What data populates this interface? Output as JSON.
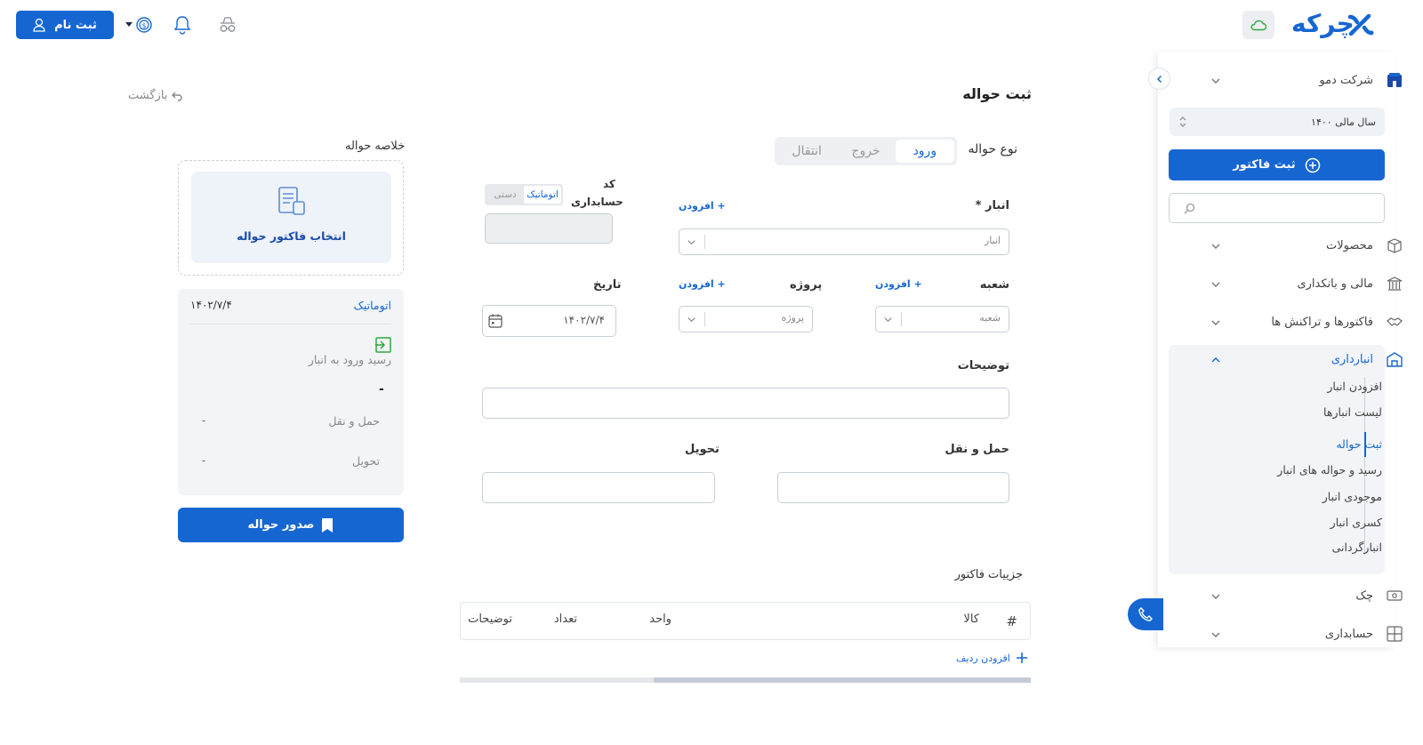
{
  "header": {
    "signup_label": "ثبت نام",
    "brand_name": "چرکه"
  },
  "sidebar": {
    "company": "شرکت دمو",
    "fiscal_year": "سال مالی ۱۴۰۰",
    "new_invoice_label": "ثبت فاکتور",
    "items": [
      {
        "label": "محصولات"
      },
      {
        "label": "مالی و بانکداری"
      },
      {
        "label": "فاکتورها و تراکنش ها"
      },
      {
        "label": "انبارداری"
      },
      {
        "label": "چک"
      },
      {
        "label": "حسابداری"
      }
    ],
    "warehouse_sub": [
      "افزودن انبار",
      "لیست انبارها",
      "ثبت حواله",
      "رسید و حواله های انبار",
      "موجودی انبار",
      "کسری انبار",
      "انبارگردانی"
    ]
  },
  "page": {
    "title": "ثبت حواله",
    "back_label": "بازگشت"
  },
  "form": {
    "type_label": "نوع حواله",
    "type_tabs": [
      "ورود",
      "خروج",
      "انتقال"
    ],
    "warehouse_label": "انبار *",
    "warehouse_placeholder": "انبار",
    "add_label": "+ افزودن",
    "code_label_1": "کد",
    "code_label_2": "حسابداری",
    "code_mode_auto": "اتوماتیک",
    "code_mode_manual": "دستی",
    "branch_label": "شعبه",
    "branch_placeholder": "شعبه",
    "project_label": "پروژه",
    "project_placeholder": "پروژه",
    "date_label": "تاریخ",
    "date_value": "۱۴۰۲/۷/۴",
    "description_label": "توضیحات",
    "shipping_label": "حمل و نقل",
    "delivery_label": "تحویل"
  },
  "invoice_details": {
    "title": "جزییات فاکتور",
    "columns": [
      "#",
      "کالا",
      "واحد",
      "تعداد",
      "توضیحات"
    ],
    "add_row_label": "افزودن ردیف"
  },
  "summary": {
    "title": "خلاصه حواله",
    "select_invoice_label": "انتخاب فاکتور حواله",
    "code_mode": "اتوماتیک",
    "date": "۱۴۰۲/۷/۴",
    "doc_type": "رسید ورود به انبار",
    "dash": "-",
    "shipping_label": "حمل و نقل",
    "shipping_value": "-",
    "delivery_label": "تحویل",
    "delivery_value": "-",
    "issue_button": "صدور حواله"
  },
  "colors": {
    "primary": "#1666d2",
    "sidebar_group_bg": "#f2f4f7",
    "success_icon": "#2eaa3c"
  }
}
